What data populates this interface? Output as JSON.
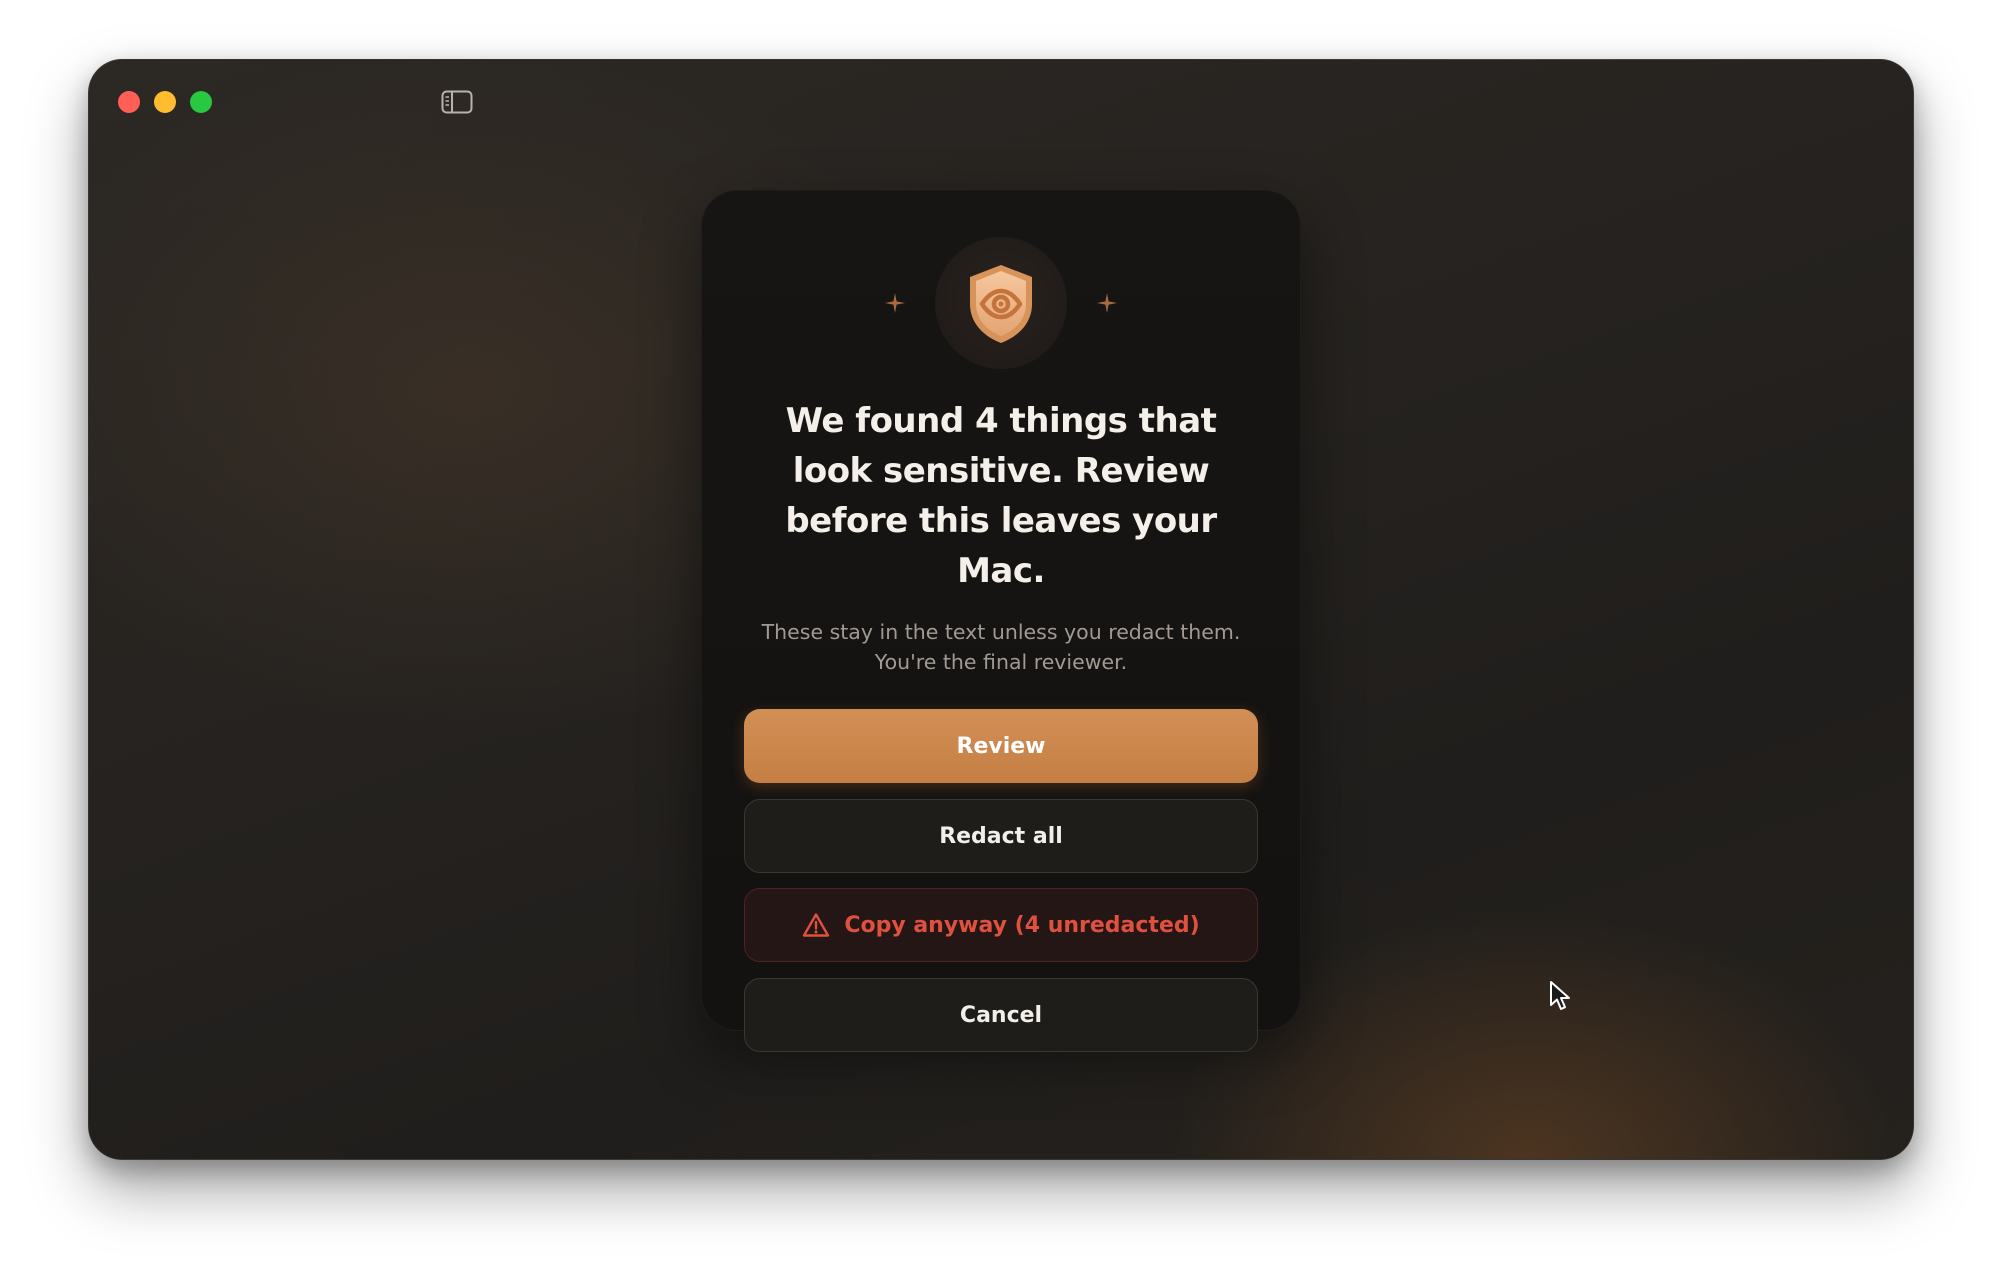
{
  "window": {
    "controls": [
      "close",
      "minimize",
      "maximize"
    ],
    "toolbar_icon": "sidebar-toggle-icon"
  },
  "dialog": {
    "icon": "shield-eye-icon",
    "decorations": [
      "sparkle-icon",
      "sparkle-icon"
    ],
    "title": "We found 4 things that look sensitive. Review before this leaves your Mac.",
    "subtitle_line1": "These stay in the text unless you redact them.",
    "subtitle_line2": "You're the final reviewer.",
    "buttons": {
      "review": "Review",
      "redact_all": "Redact all",
      "copy_anyway": "Copy anyway (4 unredacted)",
      "cancel": "Cancel"
    }
  },
  "colors": {
    "accent": "#c98548",
    "danger": "#e0503f",
    "dialog_bg": "#161412",
    "window_bg": "#25221f"
  }
}
